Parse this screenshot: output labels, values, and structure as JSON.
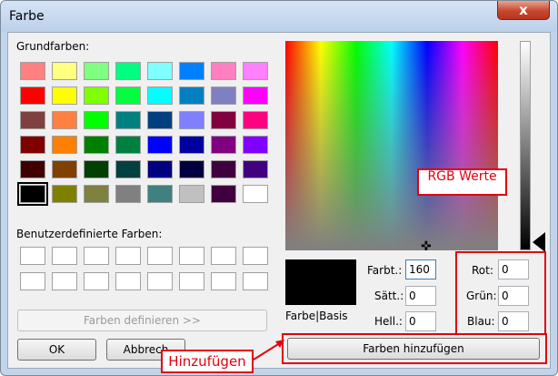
{
  "window": {
    "title": "Farbe",
    "close_glyph": "x"
  },
  "basic_colors": {
    "label": "Grundfarben:",
    "colors": [
      "#ff8080",
      "#ffff80",
      "#80ff80",
      "#00ff80",
      "#80ffff",
      "#0080ff",
      "#ff80c0",
      "#ff80ff",
      "#ff0000",
      "#ffff00",
      "#80ff00",
      "#00ff40",
      "#00ffff",
      "#0080c0",
      "#8080c0",
      "#ff00ff",
      "#804040",
      "#ff8040",
      "#00ff00",
      "#008080",
      "#004080",
      "#8080ff",
      "#800040",
      "#ff0080",
      "#800000",
      "#ff8000",
      "#008000",
      "#008040",
      "#0000ff",
      "#0000a0",
      "#800080",
      "#8000ff",
      "#400000",
      "#804000",
      "#004000",
      "#004040",
      "#000080",
      "#000040",
      "#400040",
      "#400080",
      "#000000",
      "#808000",
      "#808040",
      "#808080",
      "#408080",
      "#c0c0c0",
      "#400040",
      "#ffffff"
    ]
  },
  "custom_colors": {
    "label": "Benutzerdefinierte Farben:",
    "count": 16
  },
  "buttons": {
    "define": "Farben definieren >>",
    "ok": "OK",
    "cancel": "Abbrech",
    "add": "Farben hinzufügen"
  },
  "preview": {
    "label": "Farbe|Basis",
    "color": "#000000"
  },
  "fields": {
    "hue": {
      "label": "Farbt.:",
      "value": "160"
    },
    "sat": {
      "label": "Sätt.:",
      "value": "0"
    },
    "lum": {
      "label": "Hell.:",
      "value": "0"
    },
    "red": {
      "label": "Rot:",
      "value": "0"
    },
    "green": {
      "label": "Grün:",
      "value": "0"
    },
    "blue": {
      "label": "Blau:",
      "value": "0"
    }
  },
  "annotations": {
    "rgb": "RGB Werte",
    "add": "Hinzufügen",
    "color": "#e3000f"
  }
}
